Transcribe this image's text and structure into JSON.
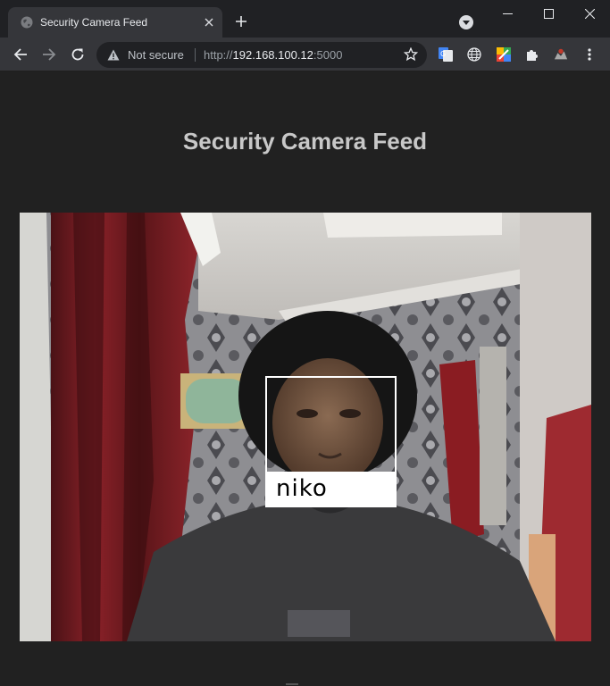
{
  "browser": {
    "tab_title": "Security Camera Feed",
    "security_label": "Not secure",
    "url_scheme": "http://",
    "url_host": "192.168.100.12",
    "url_port": ":5000"
  },
  "page": {
    "title": "Security Camera Feed"
  },
  "feed": {
    "detections": [
      {
        "label": "niko"
      }
    ]
  },
  "colors": {
    "page_bg": "#212121",
    "title_text": "#c8c8c8",
    "toolbar_bg": "#35363a",
    "omnibox_bg": "#202124",
    "box_color": "#ffffff"
  }
}
